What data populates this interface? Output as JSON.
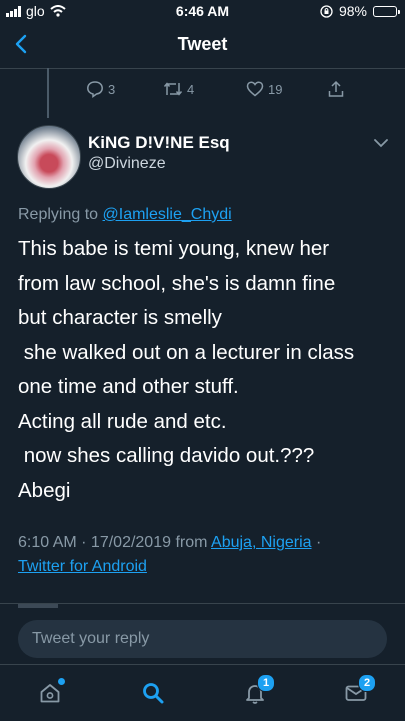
{
  "status_bar": {
    "carrier": "glo",
    "time": "6:46 AM",
    "battery": "98%",
    "battery_level": 0.98
  },
  "nav": {
    "title": "Tweet",
    "back_icon": "chevron-left-icon"
  },
  "parent_actions": {
    "replies": "3",
    "retweets": "4",
    "likes": "19"
  },
  "tweet": {
    "author_name": "KiNG D!V!NE Esq",
    "author_handle": "@Divineze",
    "replying_prefix": "Replying to ",
    "replying_to": "@Iamleslie_Chydi",
    "lines": [
      "This babe is temi young, knew her",
      "from law school, she's is damn fine",
      "but character is smelly",
      " she walked out on a lecturer in class",
      "one time and other stuff.",
      "Acting all rude and etc.",
      " now shes calling davido out.???",
      "Abegi"
    ],
    "time_date": "6:10 AM · 17/02/2019 from ",
    "location": "Abuja, Nigeria",
    "separator": " ·",
    "client": "Twitter for Android"
  },
  "reply": {
    "placeholder": "Tweet your reply"
  },
  "tabbar": {
    "notifications_badge": "1",
    "messages_badge": "2"
  },
  "colors": {
    "background": "#15202b",
    "accent": "#1da1f2",
    "muted": "#8899a6",
    "divider": "#38444d"
  }
}
